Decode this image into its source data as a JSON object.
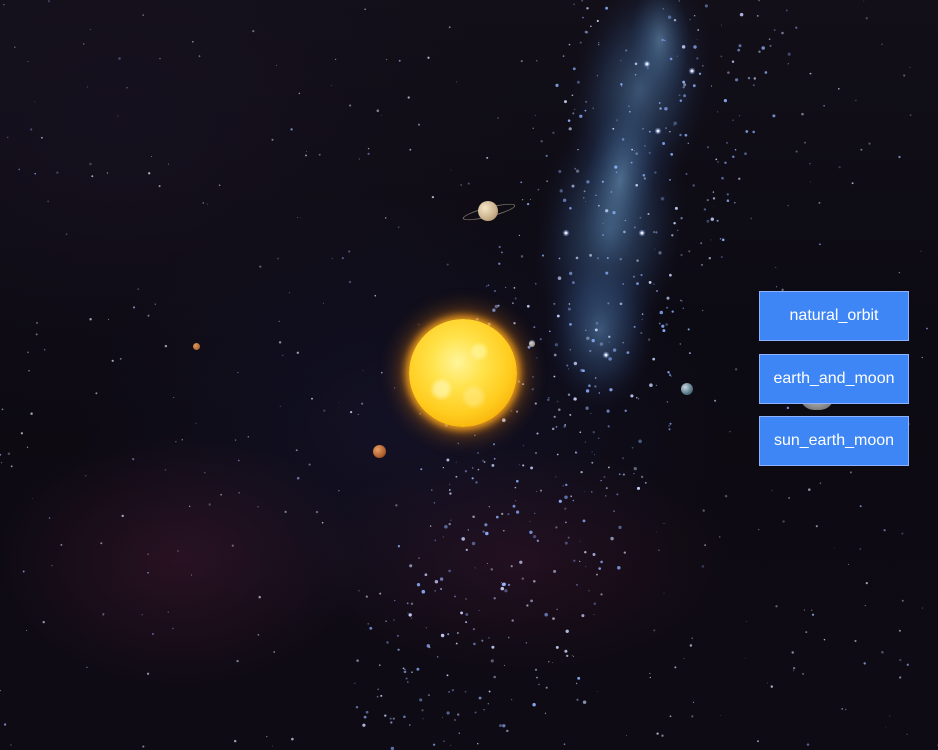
{
  "scene": {
    "bodies": [
      {
        "name": "sun",
        "icon": "sun-icon"
      },
      {
        "name": "small-grey-planet",
        "icon": "planet-icon"
      },
      {
        "name": "ringed-planet",
        "icon": "ringed-planet-icon"
      },
      {
        "name": "orange-planet",
        "icon": "planet-icon"
      },
      {
        "name": "tiny-orange-planet",
        "icon": "planet-icon"
      },
      {
        "name": "earth",
        "icon": "planet-icon"
      },
      {
        "name": "moon",
        "icon": "moon-icon"
      }
    ]
  },
  "controls": {
    "buttons": [
      {
        "label": "natural_orbit"
      },
      {
        "label": "earth_and_moon"
      },
      {
        "label": "sun_earth_moon"
      }
    ],
    "accent": "#3e86f5"
  }
}
